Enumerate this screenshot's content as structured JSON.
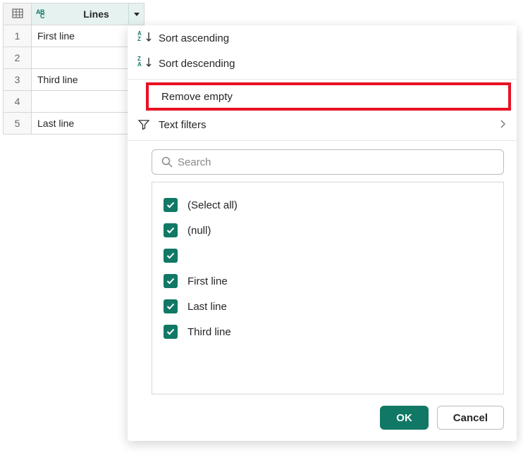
{
  "column": {
    "name": "Lines",
    "rows": [
      "First line",
      "",
      "Third line",
      "",
      "Last line"
    ],
    "row_numbers": [
      "1",
      "2",
      "3",
      "4",
      "5"
    ]
  },
  "menu": {
    "sort_asc": "Sort ascending",
    "sort_desc": "Sort descending",
    "remove_empty": "Remove empty",
    "text_filters": "Text filters",
    "search_placeholder": "Search"
  },
  "filters": {
    "items": [
      {
        "label": "(Select all)",
        "checked": true
      },
      {
        "label": "(null)",
        "checked": true
      },
      {
        "label": "",
        "checked": true
      },
      {
        "label": "First line",
        "checked": true
      },
      {
        "label": "Last line",
        "checked": true
      },
      {
        "label": "Third line",
        "checked": true
      }
    ]
  },
  "buttons": {
    "ok": "OK",
    "cancel": "Cancel"
  }
}
